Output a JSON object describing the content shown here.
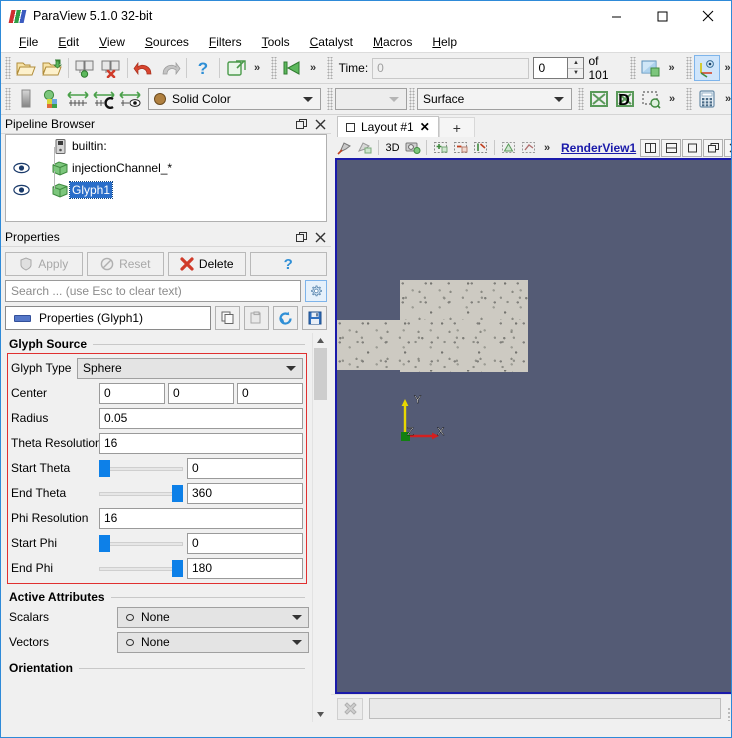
{
  "window": {
    "title": "ParaView 5.1.0 32-bit",
    "logo": "paraview-logo",
    "minimize": "—",
    "maximize": "□",
    "close": "✕"
  },
  "menubar": {
    "items": [
      {
        "label": "File",
        "mnemonic": "F"
      },
      {
        "label": "Edit",
        "mnemonic": "E"
      },
      {
        "label": "View",
        "mnemonic": "V"
      },
      {
        "label": "Sources",
        "mnemonic": "S"
      },
      {
        "label": "Filters",
        "mnemonic": "F"
      },
      {
        "label": "Tools",
        "mnemonic": "T"
      },
      {
        "label": "Catalyst",
        "mnemonic": "C"
      },
      {
        "label": "Macros",
        "mnemonic": "M"
      },
      {
        "label": "Help",
        "mnemonic": "H"
      }
    ]
  },
  "toolbar_main": {
    "buttons": [
      {
        "name": "open-file-icon",
        "tip": "Open"
      },
      {
        "name": "open-recent-icon",
        "tip": "Open Recent"
      },
      {
        "name": "save-state-icon",
        "tip": "Save State"
      },
      {
        "name": "delete-state-icon",
        "tip": "Delete State"
      },
      {
        "name": "undo-icon",
        "tip": "Undo"
      },
      {
        "name": "redo-icon",
        "tip": "Redo"
      },
      {
        "name": "help-icon",
        "tip": "Help"
      },
      {
        "name": "connect-icon",
        "tip": "Connect"
      }
    ],
    "overflow": "»"
  },
  "toolbar_time": {
    "first_frame_icon": "first-frame-icon",
    "overflow": "»",
    "time_label": "Time:",
    "time_value": "0",
    "frame_value": "0",
    "frame_total": "of 101",
    "camera_icon": "camera-undo-icon",
    "axes_icon": "center-axes-icon"
  },
  "toolbar_repr": {
    "color_by_placeholder": "",
    "solid_color": "Solid Color",
    "solid_color_swatch": "#b08040",
    "representation": "Surface",
    "buttons": [
      {
        "name": "color-legend-icon"
      },
      {
        "name": "rescale-data-range-icon"
      },
      {
        "name": "edit-color-map-icon"
      },
      {
        "name": "rescale-custom-icon"
      },
      {
        "name": "rescale-visible-icon"
      },
      {
        "name": "calculator-icon"
      }
    ],
    "overflow": "»"
  },
  "pipeline": {
    "title": "Pipeline Browser",
    "undock_icon": "undock-icon",
    "close_icon": "close-icon",
    "items": [
      {
        "label": "builtin:",
        "icon": "server-icon",
        "eye": false,
        "selected": false,
        "indent": 0
      },
      {
        "label": "injectionChannel_*",
        "icon": "source-icon",
        "eye": true,
        "selected": false,
        "indent": 1
      },
      {
        "label": "Glyph1",
        "icon": "source-icon",
        "eye": true,
        "selected": true,
        "indent": 1
      }
    ]
  },
  "properties": {
    "title": "Properties",
    "undock_icon": "undock-icon",
    "close_icon": "close-icon",
    "apply_label": "Apply",
    "reset_label": "Reset",
    "delete_label": "Delete",
    "help_label": "?",
    "search_placeholder": "Search ... (use Esc to clear text)",
    "gear_icon": "gear-icon",
    "group_label": "Properties (Glyph1)",
    "copy_icon": "copy-icon",
    "paste_icon": "paste-icon",
    "restore_icon": "restore-defaults-icon",
    "save_icon": "save-icon",
    "scroll_up": "⌃",
    "scroll_down": "⌄",
    "sections": {
      "glyph_source": {
        "title": "Glyph Source",
        "rows": [
          {
            "label": "Glyph Type",
            "type": "combo",
            "value": "Sphere"
          },
          {
            "label": "Center",
            "type": "triple",
            "values": [
              "0",
              "0",
              "0"
            ]
          },
          {
            "label": "Radius",
            "type": "text",
            "value": "0.05"
          },
          {
            "label": "Theta Resolution",
            "type": "text",
            "value": "16"
          },
          {
            "label": "Start Theta",
            "type": "slider",
            "value": "0",
            "percent": 0
          },
          {
            "label": "End Theta",
            "type": "slider",
            "value": "360",
            "percent": 100
          },
          {
            "label": "Phi Resolution",
            "type": "text",
            "value": "16"
          },
          {
            "label": "Start Phi",
            "type": "slider",
            "value": "0",
            "percent": 0
          },
          {
            "label": "End Phi",
            "type": "slider",
            "value": "180",
            "percent": 100
          }
        ]
      },
      "active_attributes": {
        "title": "Active Attributes",
        "rows": [
          {
            "label": "Scalars",
            "value": "None",
            "icon": "scalars-icon"
          },
          {
            "label": "Vectors",
            "value": "None",
            "icon": "vectors-icon"
          }
        ]
      },
      "orientation": {
        "title": "Orientation"
      }
    }
  },
  "layout": {
    "tab_label": "Layout #1",
    "tab_icon": "layout-icon",
    "tab_close": "✕",
    "new_tab": "+"
  },
  "view_toolbar": {
    "buttons": [
      {
        "name": "interact-mode-icon"
      },
      {
        "name": "select-cells-icon"
      },
      {
        "name": "mode-3d-label",
        "label": "3D"
      },
      {
        "name": "camera-icon"
      },
      {
        "name": "select-cells-on-icon"
      },
      {
        "name": "select-points-on-icon"
      },
      {
        "name": "select-cells-through-icon"
      },
      {
        "name": "select-frustum-points-icon"
      },
      {
        "name": "select-blocks-icon"
      }
    ],
    "overflow": "»",
    "view_name": "RenderView1",
    "right_buttons": [
      {
        "name": "split-horizontal-icon",
        "glyph": "◫"
      },
      {
        "name": "split-vertical-icon",
        "glyph": "▤"
      },
      {
        "name": "maximize-view-icon",
        "glyph": "□"
      },
      {
        "name": "undock-view-icon",
        "glyph": "❐"
      },
      {
        "name": "close-view-icon",
        "glyph": "✕"
      }
    ]
  },
  "render_view": {
    "background_color": "#545b75",
    "geometry_color": "#cdcac2",
    "border_color": "#1a1aaa",
    "axes": {
      "x_label": "X",
      "x_color": "#d22020",
      "y_label": "Y",
      "y_color": "#e8d800",
      "z_label": "Z",
      "z_color": "#128012"
    }
  },
  "statusbar": {
    "abort_icon": "abort-icon",
    "progress_text": "",
    "grip": "resize-grip"
  }
}
